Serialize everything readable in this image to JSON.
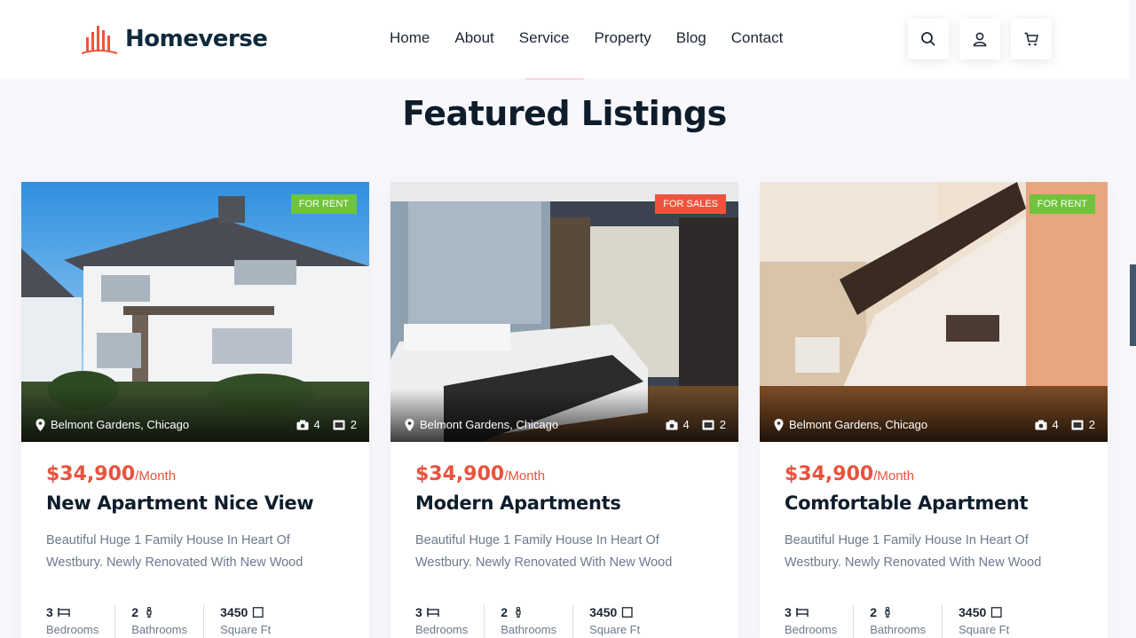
{
  "brand": {
    "name": "Homeverse"
  },
  "nav": [
    {
      "label": "Home"
    },
    {
      "label": "About"
    },
    {
      "label": "Service"
    },
    {
      "label": "Property"
    },
    {
      "label": "Blog"
    },
    {
      "label": "Contact"
    }
  ],
  "header_actions": [
    {
      "icon": "search-icon"
    },
    {
      "icon": "user-icon"
    },
    {
      "icon": "cart-icon"
    }
  ],
  "section": {
    "title": "Featured Listings"
  },
  "listings": [
    {
      "badge": "FOR RENT",
      "badge_color": "#6ec43a",
      "location": "Belmont Gardens, Chicago",
      "photos": "4",
      "videos": "2",
      "price": "$34,900",
      "price_unit": "/Month",
      "title": "New Apartment Nice View",
      "description": "Beautiful Huge 1 Family House In Heart Of Westbury. Newly Renovated With New Wood",
      "bedrooms": "3",
      "bedrooms_label": "Bedrooms",
      "bathrooms": "2",
      "bathrooms_label": "Bathrooms",
      "area": "3450",
      "area_label": "Square Ft"
    },
    {
      "badge": "FOR SALES",
      "badge_color": "#f0533d",
      "location": "Belmont Gardens, Chicago",
      "photos": "4",
      "videos": "2",
      "price": "$34,900",
      "price_unit": "/Month",
      "title": "Modern Apartments",
      "description": "Beautiful Huge 1 Family House In Heart Of Westbury. Newly Renovated With New Wood",
      "bedrooms": "3",
      "bedrooms_label": "Bedrooms",
      "bathrooms": "2",
      "bathrooms_label": "Bathrooms",
      "area": "3450",
      "area_label": "Square Ft"
    },
    {
      "badge": "FOR RENT",
      "badge_color": "#6ec43a",
      "location": "Belmont Gardens, Chicago",
      "photos": "4",
      "videos": "2",
      "price": "$34,900",
      "price_unit": "/Month",
      "title": "Comfortable Apartment",
      "description": "Beautiful Huge 1 Family House In Heart Of Westbury. Newly Renovated With New Wood",
      "bedrooms": "3",
      "bedrooms_label": "Bedrooms",
      "bathrooms": "2",
      "bathrooms_label": "Bathrooms",
      "area": "3450",
      "area_label": "Square Ft"
    }
  ],
  "colors": {
    "accent": "#e9533d",
    "navy": "#0e2a3b",
    "rent": "#6ec43a",
    "sale": "#f0533d"
  }
}
